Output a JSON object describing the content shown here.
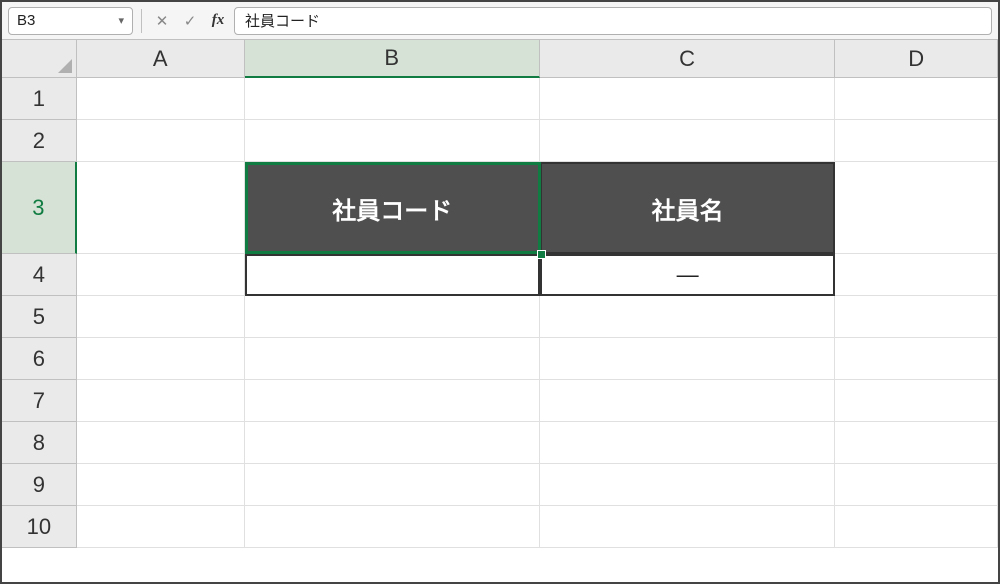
{
  "name_box": {
    "value": "B3"
  },
  "formula_input": {
    "value": "社員コード"
  },
  "columns": [
    "A",
    "B",
    "C",
    "D"
  ],
  "rows": [
    "1",
    "2",
    "3",
    "4",
    "5",
    "6",
    "7",
    "8",
    "9",
    "10"
  ],
  "active_cell": "B3",
  "cells": {
    "B3": "社員コード",
    "C3": "社員名",
    "B4": "",
    "C4": "―"
  }
}
